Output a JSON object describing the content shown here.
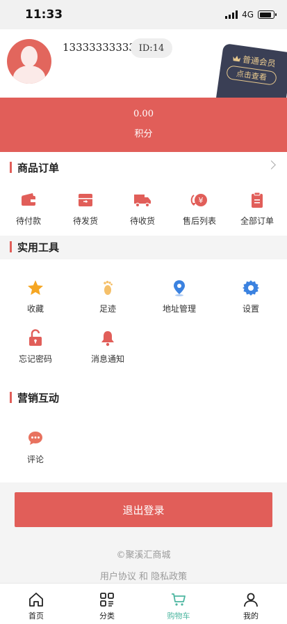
{
  "status": {
    "time": "11:33",
    "network": "4G"
  },
  "profile": {
    "phone": "13333333333",
    "id_label": "ID:14",
    "member_level": "普通会员",
    "member_action": "点击查看"
  },
  "points": {
    "value": "0.00",
    "label": "积分"
  },
  "orders": {
    "title": "商品订单",
    "items": [
      {
        "label": "待付款",
        "icon": "wallet-icon"
      },
      {
        "label": "待发货",
        "icon": "box-icon"
      },
      {
        "label": "待收货",
        "icon": "truck-icon"
      },
      {
        "label": "售后列表",
        "icon": "refund-icon"
      },
      {
        "label": "全部订单",
        "icon": "clipboard-icon"
      }
    ]
  },
  "tools": {
    "title": "实用工具",
    "items": [
      {
        "label": "收藏",
        "icon": "star-icon"
      },
      {
        "label": "足迹",
        "icon": "footprint-icon"
      },
      {
        "label": "地址管理",
        "icon": "location-icon"
      },
      {
        "label": "设置",
        "icon": "gear-icon"
      },
      {
        "label": "忘记密码",
        "icon": "unlock-icon"
      },
      {
        "label": "消息通知",
        "icon": "bell-icon"
      }
    ]
  },
  "marketing": {
    "title": "营销互动",
    "items": [
      {
        "label": "评论",
        "icon": "comment-icon"
      }
    ]
  },
  "footer": {
    "logout": "退出登录",
    "copyright": "©聚溪汇商城",
    "policy": "用户协议 和 隐私政策"
  },
  "tabbar": {
    "items": [
      {
        "label": "首页",
        "icon": "home-icon"
      },
      {
        "label": "分类",
        "icon": "category-icon"
      },
      {
        "label": "购物车",
        "icon": "cart-icon"
      },
      {
        "label": "我的",
        "icon": "user-icon"
      }
    ],
    "active_index": 2
  },
  "colors": {
    "accent": "#e15e59",
    "icon_orange": "#f5a623",
    "icon_blue": "#3b82e0",
    "tab_active": "#4db6a0"
  }
}
